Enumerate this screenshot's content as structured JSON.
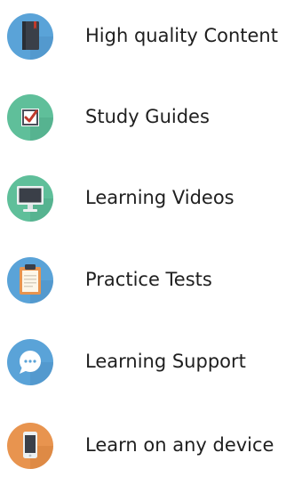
{
  "features": [
    {
      "label": "High quality Content",
      "icon": "book-icon",
      "color": "#5aa3d8"
    },
    {
      "label": "Study Guides",
      "icon": "checkbox-icon",
      "color": "#5fbf9a"
    },
    {
      "label": "Learning Videos",
      "icon": "monitor-icon",
      "color": "#5fbf9a"
    },
    {
      "label": "Practice Tests",
      "icon": "clipboard-icon",
      "color": "#5aa3d8"
    },
    {
      "label": "Learning Support",
      "icon": "chat-bubble-icon",
      "color": "#5aa3d8"
    },
    {
      "label": "Learn on any device",
      "icon": "smartphone-icon",
      "color": "#e8944f"
    }
  ]
}
